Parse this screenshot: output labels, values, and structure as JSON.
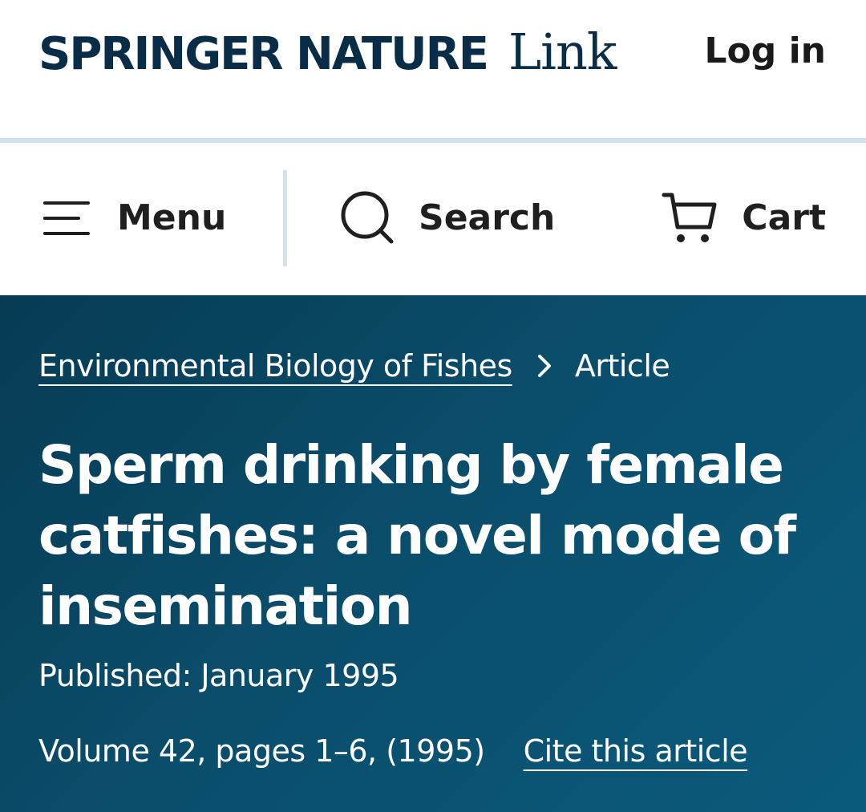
{
  "header": {
    "brand_name": "SPRINGER NATURE",
    "brand_suffix": "Link",
    "login_label": "Log in",
    "brand_color": "#0a2d47"
  },
  "nav": {
    "menu_label": "Menu",
    "search_label": "Search",
    "cart_label": "Cart",
    "icons": [
      "menu-icon",
      "search-icon",
      "cart-icon"
    ]
  },
  "hero": {
    "background_color": "#0a4d6b",
    "breadcrumb": {
      "journal": "Environmental Biology of Fishes",
      "current": "Article"
    },
    "title": "Sperm drinking by female catfishes: a novel mode of insemination",
    "published": "Published: January 1995",
    "volume": "Volume 42, pages 1–6, (1995)",
    "cite_label": "Cite this article"
  }
}
